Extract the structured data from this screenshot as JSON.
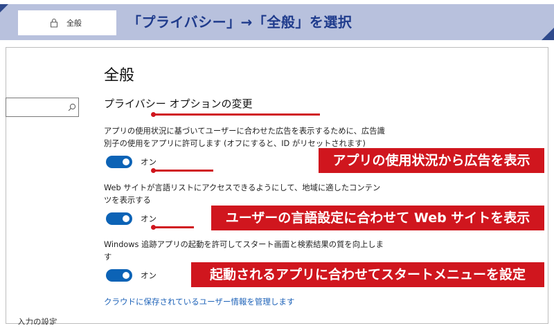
{
  "banner": {
    "nav_label": "全般",
    "title": "「プライバシー」→「全般」を選択"
  },
  "settings": {
    "page_title": "全般",
    "section_title": "プライバシー オプションの変更",
    "options": [
      {
        "description": "アプリの使用状況に基づいてユーザーに合わせた広告を表示するために、広告識別子の使用をアプリに許可します (オフにすると、ID がリセットされます)",
        "state": "オン"
      },
      {
        "description": "Web サイトが言語リストにアクセスできるようにして、地域に適したコンテンツを表示する",
        "state": "オン"
      },
      {
        "description": "Windows 追跡アプリの起動を許可してスタート画面と検索結果の質を向上します",
        "state": "オン"
      }
    ],
    "link": "クラウドに保存されているユーザー情報を管理します",
    "cut_text": "入力の設定"
  },
  "callouts": [
    "アプリの使用状況から広告を表示",
    "ユーザーの言語設定に合わせて Web サイトを表示",
    "起動されるアプリに合わせてスタートメニューを設定"
  ],
  "colors": {
    "accent": "#0c63b6",
    "callout": "#d0161e",
    "banner_band": "#b8c1dd",
    "banner_title": "#1f3b8c"
  }
}
